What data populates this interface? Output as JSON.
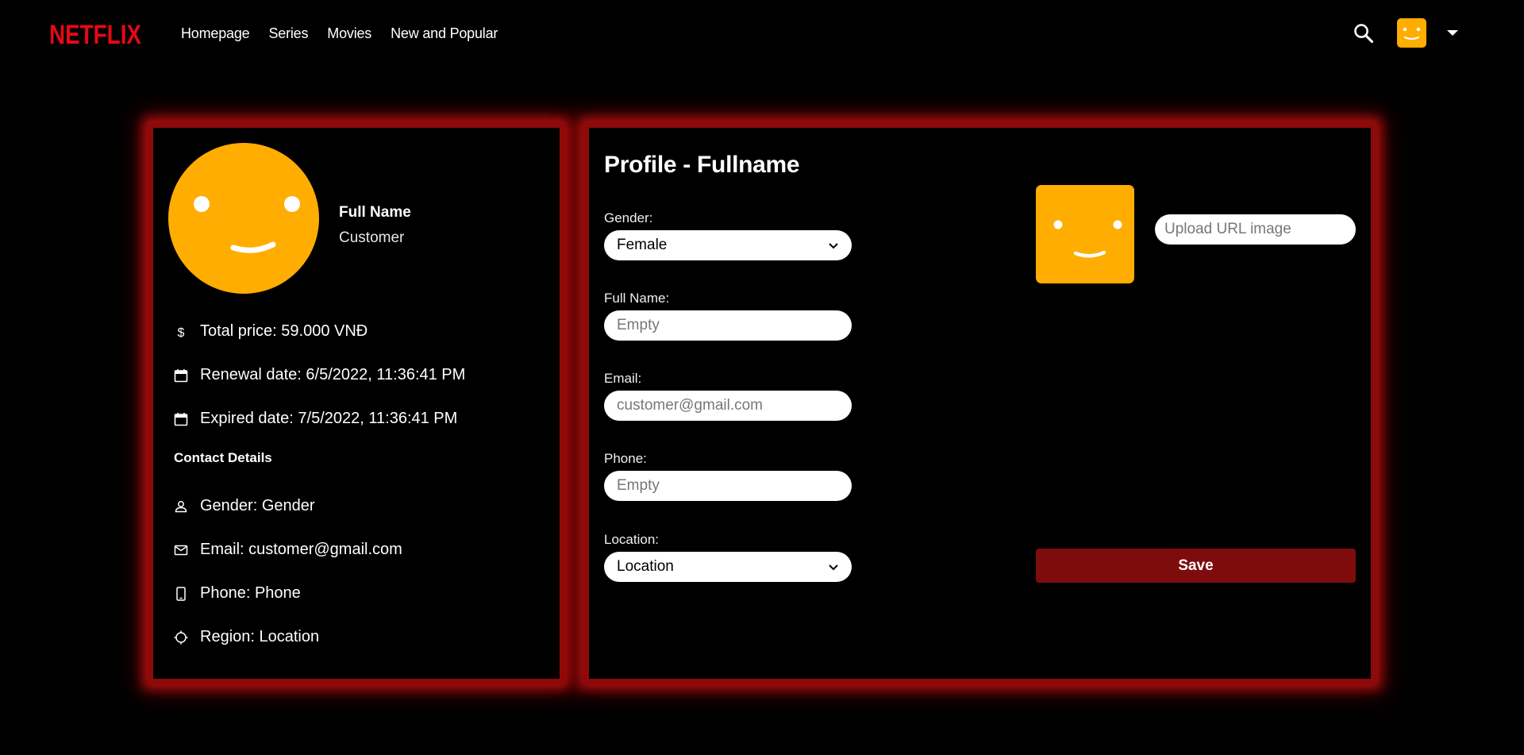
{
  "brand": {
    "name": "NETFLIX",
    "color": "#E50914"
  },
  "nav": {
    "items": [
      {
        "label": "Homepage"
      },
      {
        "label": "Series"
      },
      {
        "label": "Movies"
      },
      {
        "label": "New and Popular"
      }
    ]
  },
  "header": {
    "search_icon": "search-icon",
    "avatar_color": "#FFAD00",
    "dropdown_icon": "caret-down-icon"
  },
  "summary": {
    "full_name_label": "Full Name",
    "role": "Customer",
    "total_price": "Total price: 59.000 VNĐ",
    "renewal_date": "Renewal date: 6/5/2022, 11:36:41 PM",
    "expired_date": "Expired date: 7/5/2022, 11:36:41 PM",
    "contact_title": "Contact Details",
    "gender": "Gender: Gender",
    "email": "Email: customer@gmail.com",
    "phone": "Phone: Phone",
    "region": "Region: Location"
  },
  "form": {
    "title": "Profile - Fullname",
    "gender_label": "Gender:",
    "gender_value": "Female",
    "fullname_label": "Full Name:",
    "fullname_placeholder": "Empty",
    "email_label": "Email:",
    "email_placeholder": "customer@gmail.com",
    "phone_label": "Phone:",
    "phone_placeholder": "Empty",
    "location_label": "Location:",
    "location_value": "Location",
    "upload_placeholder": "Upload URL image",
    "save_label": "Save"
  },
  "colors": {
    "accent": "#E50914",
    "card_border": "#8E0A0A",
    "save_button": "#7E0C0C",
    "avatar": "#FFAD00"
  }
}
